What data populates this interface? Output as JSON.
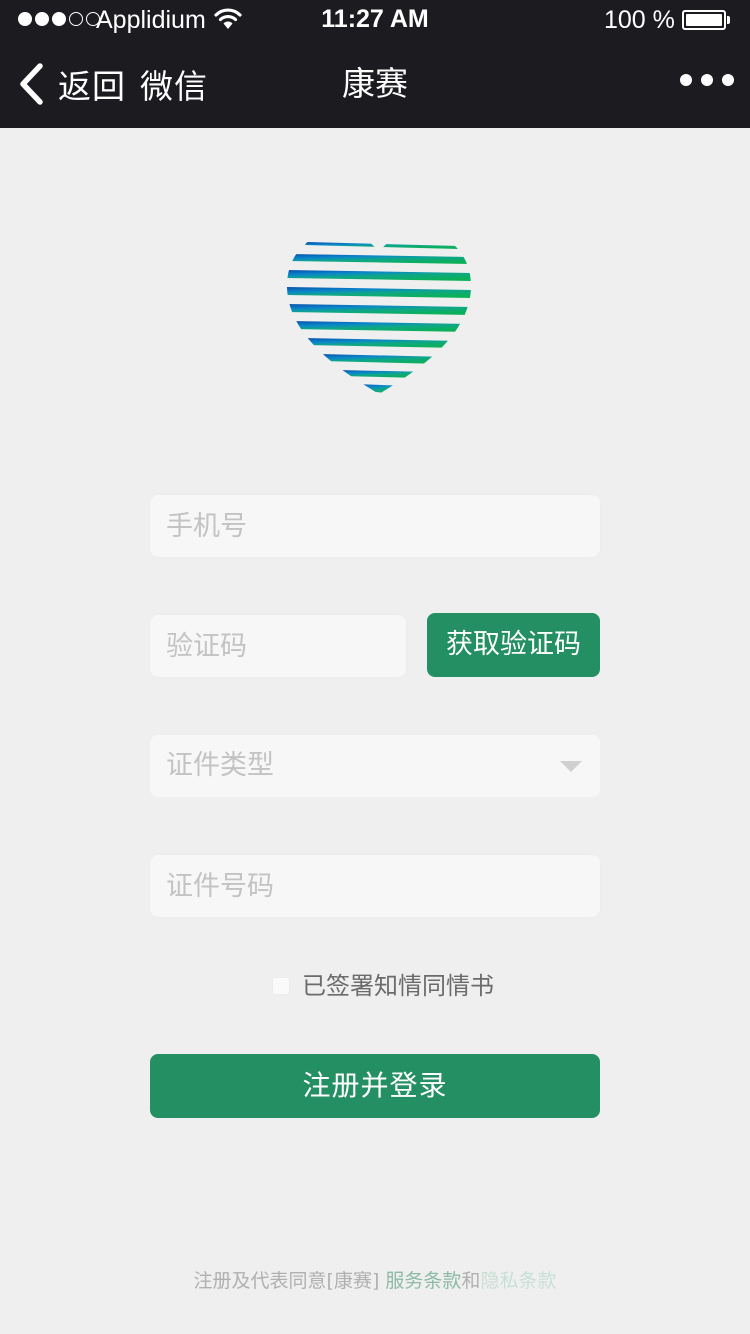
{
  "status_bar": {
    "carrier": "Applidium",
    "time": "11:27 AM",
    "battery": "100 %"
  },
  "nav": {
    "back_label": "返回",
    "back_app": "微信",
    "title": "康赛"
  },
  "form": {
    "phone_placeholder": "手机号",
    "code_placeholder": "验证码",
    "get_code_button": "获取验证码",
    "id_type_placeholder": "证件类型",
    "id_number_placeholder": "证件号码",
    "consent_label": "已签署知情同情书",
    "submit_button": "注册并登录"
  },
  "footer": {
    "prefix": "注册及代表同意[康赛] ",
    "service_terms": "服务条款",
    "joiner": "和",
    "privacy_terms": "隐私条款"
  },
  "colors": {
    "nav_background": "#1c1b20",
    "primary_green": "#248f62",
    "page_background": "#efefef"
  }
}
